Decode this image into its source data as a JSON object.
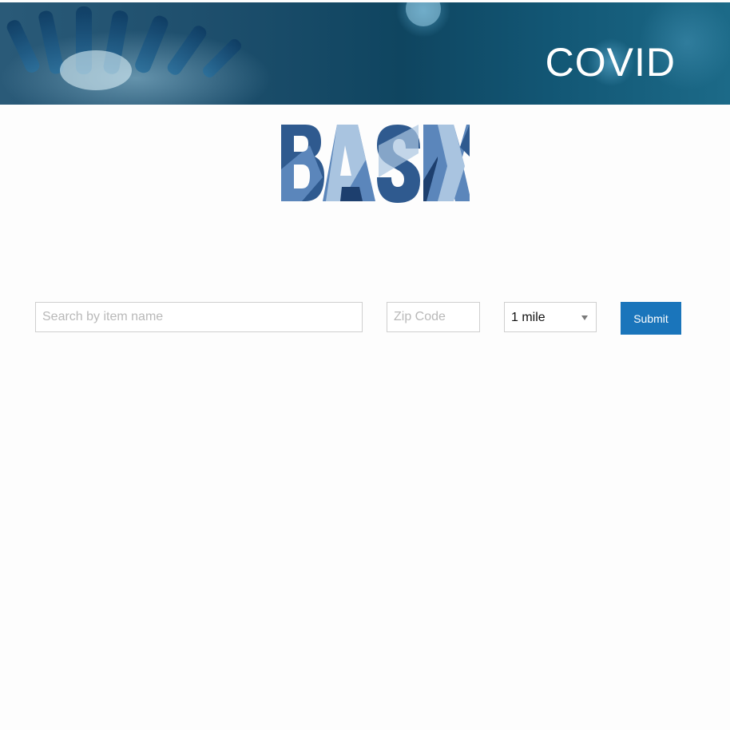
{
  "banner": {
    "title": "COVID",
    "image": "coronavirus-banner-image"
  },
  "logo": {
    "text": "BASIX",
    "colors": [
      "#2f5a8f",
      "#5b86bb",
      "#a9c4e0",
      "#1d3f6e"
    ]
  },
  "search": {
    "item_placeholder": "Search by item name",
    "item_value": "",
    "zip_placeholder": "Zip Code",
    "zip_value": "",
    "radius_selected": "1 mile",
    "submit_label": "Submit"
  },
  "colors": {
    "accent": "#1a75bb",
    "banner": "#134c69"
  }
}
